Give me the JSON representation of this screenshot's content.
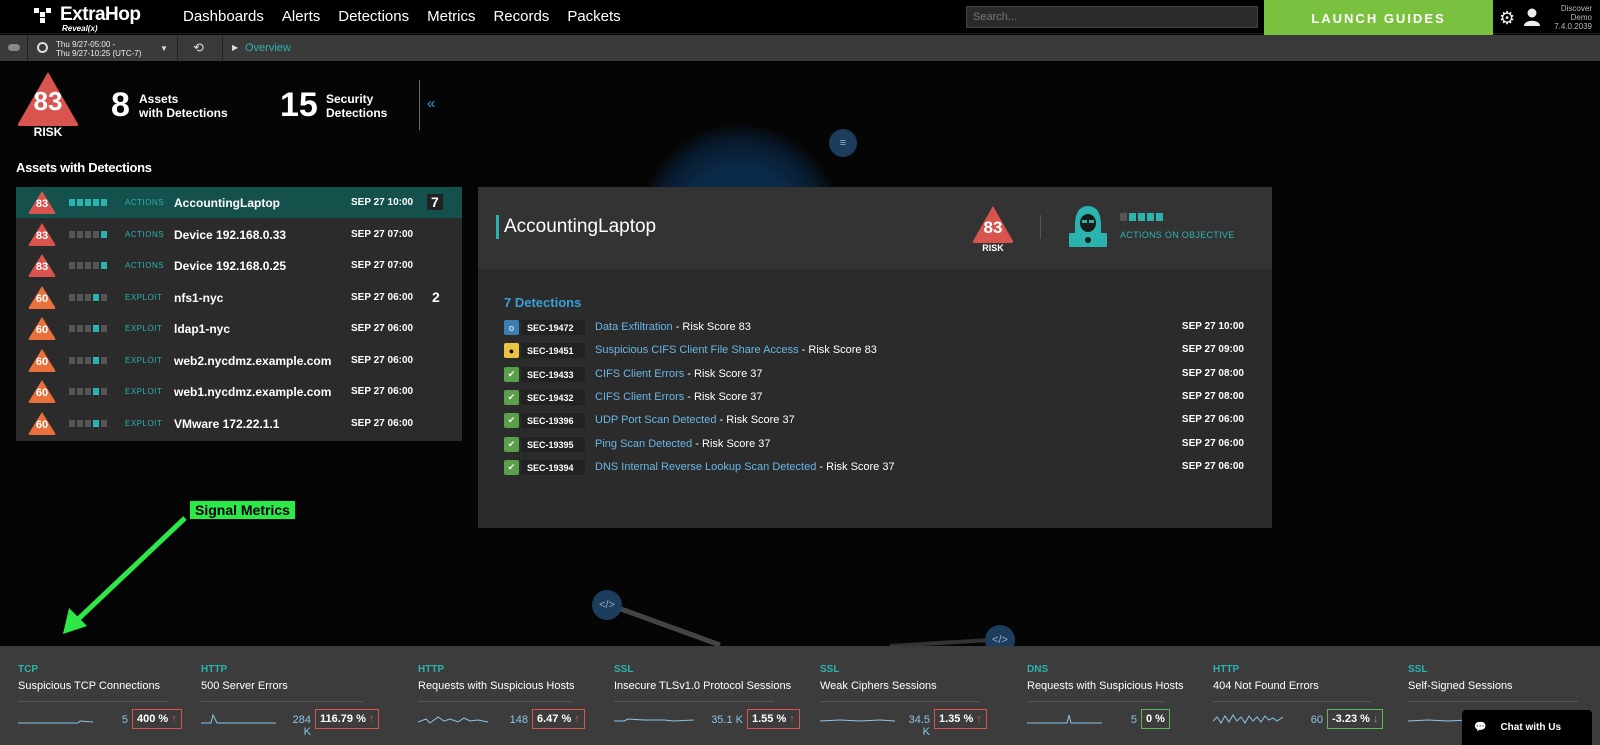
{
  "header": {
    "brand": "ExtraHop",
    "brand_sub": "Reveal(x)",
    "nav": [
      "Dashboards",
      "Alerts",
      "Detections",
      "Metrics",
      "Records",
      "Packets"
    ],
    "search_placeholder": "Search...",
    "launch_label": "LAUNCH GUIDES",
    "version_lines": [
      "Discover",
      "Demo",
      "7.4.0.2039"
    ],
    "accent_color": "#7ac13f"
  },
  "subbar": {
    "time_line1": "Thu 9/27-05:00 -",
    "time_line2": "Thu 9/27-10:25 (UTC-7)",
    "breadcrumb": "Overview"
  },
  "summary": {
    "risk_score": "83",
    "risk_label": "RISK",
    "assets_count": "8",
    "assets_label1": "Assets",
    "assets_label2": "with Detections",
    "detections_count": "15",
    "detections_label1": "Security",
    "detections_label2": "Detections"
  },
  "assets_title": "Assets with Detections",
  "assets": [
    {
      "risk": "83",
      "color": "#d9534f",
      "steps": 5,
      "stage": "ACTIONS",
      "name": "AccountingLaptop",
      "date": "SEP 27 10:00",
      "count": "7",
      "active": true
    },
    {
      "risk": "83",
      "color": "#d9534f",
      "steps": 1,
      "stage": "ACTIONS",
      "name": "Device 192.168.0.33",
      "date": "SEP 27 07:00",
      "count": "",
      "active": false
    },
    {
      "risk": "83",
      "color": "#d9534f",
      "steps": 1,
      "stage": "ACTIONS",
      "name": "Device 192.168.0.25",
      "date": "SEP 27 07:00",
      "count": "",
      "active": false
    },
    {
      "risk": "60",
      "color": "#e8703a",
      "steps": 2,
      "stage": "EXPLOIT",
      "name": "nfs1-nyc",
      "date": "SEP 27 06:00",
      "count": "2",
      "active": false
    },
    {
      "risk": "60",
      "color": "#e8703a",
      "steps": 2,
      "stage": "EXPLOIT",
      "name": "ldap1-nyc",
      "date": "SEP 27 06:00",
      "count": "",
      "active": false
    },
    {
      "risk": "60",
      "color": "#e8703a",
      "steps": 2,
      "stage": "EXPLOIT",
      "name": "web2.nycdmz.example.com",
      "date": "SEP 27 06:00",
      "count": "",
      "active": false
    },
    {
      "risk": "60",
      "color": "#e8703a",
      "steps": 2,
      "stage": "EXPLOIT",
      "name": "web1.nycdmz.example.com",
      "date": "SEP 27 06:00",
      "count": "",
      "active": false
    },
    {
      "risk": "60",
      "color": "#e8703a",
      "steps": 2,
      "stage": "EXPLOIT",
      "name": "VMware 172.22.1.1",
      "date": "SEP 27 06:00",
      "count": "",
      "active": false
    }
  ],
  "detail": {
    "name": "AccountingLaptop",
    "risk": "83",
    "risk_label": "RISK",
    "stage": "ACTIONS ON OBJECTIVE",
    "detections_title": "7 Detections",
    "detections": [
      {
        "icon": "info",
        "id": "SEC-19472",
        "title": "Data Exfiltration",
        "score": " - Risk Score 83",
        "date": "SEP 27 10:00"
      },
      {
        "icon": "warning",
        "id": "SEC-19451",
        "title": "Suspicious CIFS Client File Share Access",
        "score": " - Risk Score 83",
        "date": "SEP 27 09:00"
      },
      {
        "icon": "check",
        "id": "SEC-19433",
        "title": "CIFS Client Errors",
        "score": " - Risk Score 37",
        "date": "SEP 27 08:00"
      },
      {
        "icon": "check",
        "id": "SEC-19432",
        "title": "CIFS Client Errors",
        "score": " - Risk Score 37",
        "date": "SEP 27 08:00"
      },
      {
        "icon": "check",
        "id": "SEC-19396",
        "title": "UDP Port Scan Detected",
        "score": " - Risk Score 37",
        "date": "SEP 27 06:00"
      },
      {
        "icon": "check",
        "id": "SEC-19395",
        "title": "Ping Scan Detected",
        "score": " - Risk Score 37",
        "date": "SEP 27 06:00"
      },
      {
        "icon": "check",
        "id": "SEC-19394",
        "title": "DNS Internal Reverse Lookup Scan Detected",
        "score": " - Risk Score 37",
        "date": "SEP 27 06:00"
      }
    ]
  },
  "annotation": "Signal Metrics",
  "metrics": [
    {
      "cat": "TCP",
      "name": "Suspicious TCP Connections",
      "value": "5",
      "pct": "400 %",
      "trend": "up"
    },
    {
      "cat": "HTTP",
      "name": "500 Server Errors",
      "value": "284 K",
      "pct": "116.79 %",
      "trend": "up"
    },
    {
      "cat": "HTTP",
      "name": "Requests with Suspicious Hosts",
      "value": "148",
      "pct": "6.47 %",
      "trend": "up"
    },
    {
      "cat": "SSL",
      "name": "Insecure TLSv1.0 Protocol Sessions",
      "value": "35.1 K",
      "pct": "1.55 %",
      "trend": "up"
    },
    {
      "cat": "SSL",
      "name": "Weak Ciphers Sessions",
      "value": "34.5 K",
      "pct": "1.35 %",
      "trend": "up"
    },
    {
      "cat": "DNS",
      "name": "Requests with Suspicious Hosts",
      "value": "5",
      "pct": "0 %",
      "trend": "none"
    },
    {
      "cat": "HTTP",
      "name": "404 Not Found Errors",
      "value": "60",
      "pct": "-3.23 %",
      "trend": "down"
    },
    {
      "cat": "SSL",
      "name": "Self-Signed Sessions",
      "value": "",
      "pct": "",
      "trend": "none"
    }
  ],
  "chat_label": "Chat with Us"
}
